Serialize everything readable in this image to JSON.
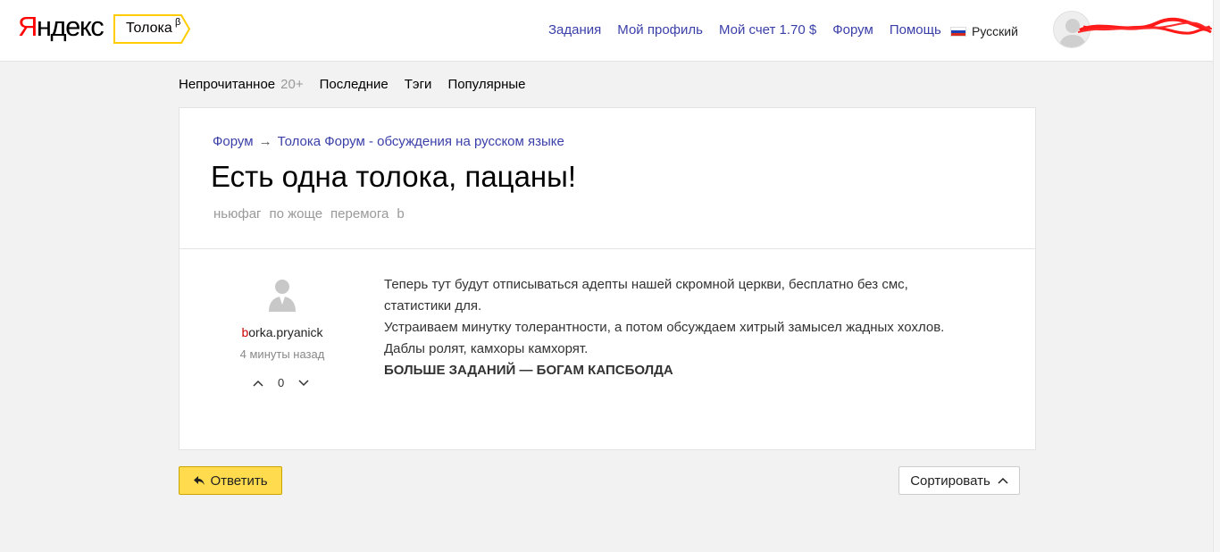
{
  "header": {
    "logo_first": "Я",
    "logo_rest": "ндекс",
    "badge_label": "Толока",
    "badge_sup": "β",
    "nav": [
      "Задания",
      "Мой профиль",
      "Мой счет 1.70 $",
      "Форум",
      "Помощь"
    ],
    "language": "Русский"
  },
  "tabs": {
    "unread": "Непрочитанное",
    "unread_count": "20+",
    "recent": "Последние",
    "tags": "Тэги",
    "popular": "Популярные"
  },
  "topic": {
    "crumb_root": "Форум",
    "crumb_arrow": "→",
    "crumb_category": "Толока Форум - обсуждения на русском языке",
    "title": "Есть одна толока, пацаны!",
    "tags": [
      "ньюфаг",
      "по жоще",
      "перемога",
      "b"
    ]
  },
  "post": {
    "author_initial": "b",
    "author_rest": "orka.pryanick",
    "time": "4 минуты назад",
    "votes": "0",
    "lines": [
      "Теперь тут будут отписываться адепты нашей скромной церкви, бесплатно без смс, статистики для.",
      "Устраиваем минутку толерантности, а потом обсуждаем хитрый замысел жадных хохлов.",
      "Даблы ролят, камхоры камхорят."
    ],
    "bold_line": "БОЛЬШЕ ЗАДАНИЙ — БОГАМ КАПСБОЛДА"
  },
  "actions": {
    "reply": "Ответить",
    "sort": "Сортировать"
  },
  "colors": {
    "link": "#3a3fa8",
    "accent_yellow": "#ffdb4d",
    "logo_red": "#ff0000"
  }
}
